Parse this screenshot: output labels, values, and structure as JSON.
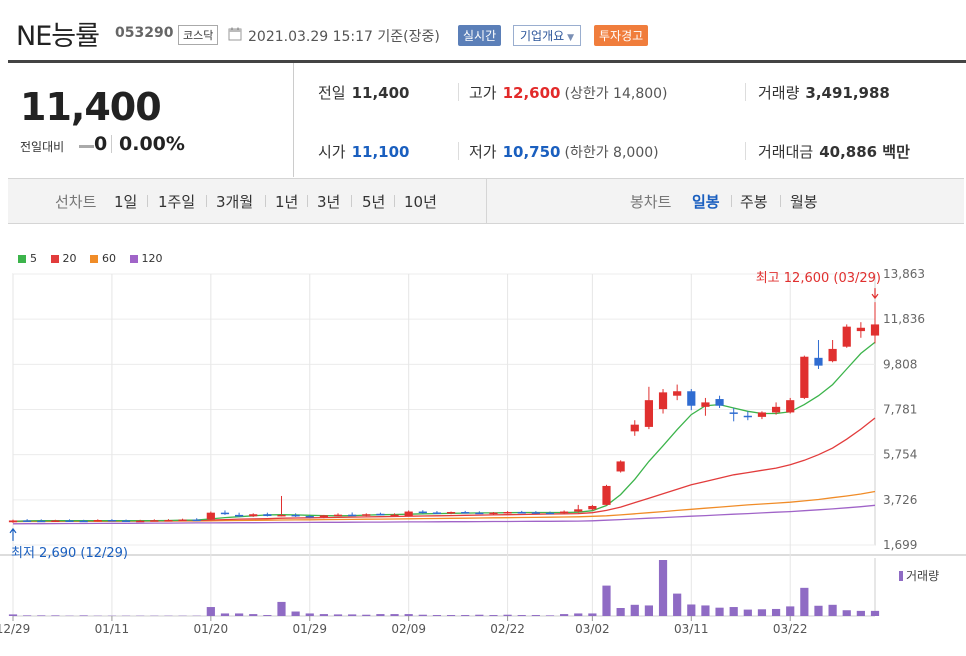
{
  "header": {
    "name": "NE능률",
    "code": "053290",
    "market": "코스닥",
    "datetime": "2021.03.29 15:17  기준(장중)",
    "btn_live": "실시간",
    "btn_info": "기업개요",
    "btn_warn": "투자경고"
  },
  "price": {
    "current": "11,400",
    "change_label": "전일대비",
    "change_value": "0",
    "change_rate": "0.00%"
  },
  "quote": {
    "prev_label": "전일",
    "prev": "11,400",
    "high_label": "고가",
    "high": "12,600",
    "upper_limit": "(상한가 14,800)",
    "volume_label": "거래량",
    "volume": "3,491,988",
    "open_label": "시가",
    "open": "11,100",
    "low_label": "저가",
    "low": "10,750",
    "lower_limit": "(하한가 8,000)",
    "amount_label": "거래대금",
    "amount": "40,886 백만"
  },
  "tabs": {
    "line_title": "선차트",
    "line": [
      "1일",
      "1주일",
      "3개월",
      "1년",
      "3년",
      "5년",
      "10년"
    ],
    "candle_title": "봉차트",
    "candle": [
      "일봉",
      "주봉",
      "월봉"
    ],
    "candle_active": 0
  },
  "chart_data": {
    "type": "candlestick",
    "legend": [
      {
        "name": "5",
        "color": "#3cb44b"
      },
      {
        "name": "20",
        "color": "#e23c3c"
      },
      {
        "name": "60",
        "color": "#f08c28"
      },
      {
        "name": "120",
        "color": "#a064c8"
      }
    ],
    "yticks": [
      "13,863",
      "11,836",
      "9,808",
      "7,781",
      "5,754",
      "3,726",
      "1,699"
    ],
    "ylim": [
      1699,
      13863
    ],
    "xticks": [
      "12/29",
      "01/11",
      "01/20",
      "01/29",
      "02/09",
      "02/22",
      "03/02",
      "03/11",
      "03/22"
    ],
    "xtick_index": [
      0,
      7,
      14,
      21,
      28,
      35,
      41,
      48,
      55
    ],
    "max_label": "최고 12,600 (03/29)",
    "min_label": "최저 2,690 (12/29)",
    "volume_label": "거래량",
    "ohlc": [
      [
        2720,
        2840,
        2690,
        2800
      ],
      [
        2800,
        2860,
        2760,
        2790
      ],
      [
        2790,
        2850,
        2750,
        2780
      ],
      [
        2780,
        2830,
        2740,
        2800
      ],
      [
        2800,
        2850,
        2760,
        2790
      ],
      [
        2790,
        2830,
        2750,
        2770
      ],
      [
        2770,
        2850,
        2750,
        2820
      ],
      [
        2820,
        2860,
        2780,
        2800
      ],
      [
        2800,
        2840,
        2760,
        2780
      ],
      [
        2780,
        2830,
        2750,
        2790
      ],
      [
        2790,
        2850,
        2760,
        2810
      ],
      [
        2810,
        2860,
        2780,
        2820
      ],
      [
        2820,
        2880,
        2790,
        2840
      ],
      [
        2840,
        2900,
        2800,
        2830
      ],
      [
        2850,
        3200,
        2820,
        3150
      ],
      [
        3150,
        3250,
        3050,
        3100
      ],
      [
        3050,
        3150,
        2950,
        2980
      ],
      [
        2990,
        3120,
        2960,
        3080
      ],
      [
        3080,
        3150,
        2980,
        3000
      ],
      [
        3000,
        3900,
        2980,
        3050
      ],
      [
        3050,
        3120,
        2960,
        3020
      ],
      [
        3000,
        3050,
        2920,
        2950
      ],
      [
        2950,
        3050,
        2900,
        3030
      ],
      [
        3030,
        3120,
        2990,
        3060
      ],
      [
        3060,
        3160,
        3000,
        3050
      ],
      [
        3050,
        3120,
        2990,
        3080
      ],
      [
        3100,
        3150,
        3030,
        3040
      ],
      [
        3040,
        3120,
        3000,
        3060
      ],
      [
        3000,
        3250,
        2980,
        3200
      ],
      [
        3200,
        3260,
        3100,
        3150
      ],
      [
        3160,
        3220,
        3100,
        3130
      ],
      [
        3130,
        3200,
        3080,
        3180
      ],
      [
        3180,
        3230,
        3120,
        3150
      ],
      [
        3150,
        3210,
        3090,
        3120
      ],
      [
        3120,
        3180,
        3060,
        3150
      ],
      [
        3150,
        3220,
        3100,
        3180
      ],
      [
        3180,
        3230,
        3120,
        3170
      ],
      [
        3170,
        3220,
        3100,
        3150
      ],
      [
        3150,
        3200,
        3080,
        3120
      ],
      [
        3150,
        3250,
        3100,
        3200
      ],
      [
        3200,
        3500,
        3150,
        3300
      ],
      [
        3300,
        3500,
        3250,
        3450
      ],
      [
        3500,
        4400,
        3480,
        4350
      ],
      [
        5000,
        5500,
        4950,
        5450
      ],
      [
        6800,
        7300,
        6600,
        7100
      ],
      [
        7000,
        8800,
        6900,
        8200
      ],
      [
        7800,
        8700,
        7600,
        8550
      ],
      [
        8400,
        8900,
        8200,
        8600
      ],
      [
        8600,
        8700,
        7750,
        7950
      ],
      [
        7900,
        8300,
        7500,
        8100
      ],
      [
        8250,
        8400,
        7850,
        7950
      ],
      [
        7650,
        7850,
        7250,
        7600
      ],
      [
        7500,
        7700,
        7300,
        7450
      ],
      [
        7450,
        7700,
        7350,
        7650
      ],
      [
        7650,
        8100,
        7550,
        7900
      ],
      [
        7650,
        8300,
        7600,
        8200
      ],
      [
        8300,
        10200,
        8250,
        10150
      ],
      [
        10100,
        10900,
        9600,
        9750
      ],
      [
        9950,
        10900,
        9900,
        10500
      ],
      [
        10600,
        11600,
        10550,
        11500
      ],
      [
        11300,
        11700,
        11000,
        11450
      ],
      [
        11100,
        12600,
        10750,
        11600
      ]
    ],
    "ma5": [
      2760,
      2780,
      2790,
      2790,
      2790,
      2790,
      2790,
      2790,
      2790,
      2790,
      2790,
      2800,
      2810,
      2820,
      2870,
      2930,
      2970,
      3010,
      3050,
      3060,
      3050,
      3030,
      3020,
      3010,
      3020,
      3040,
      3060,
      3070,
      3080,
      3100,
      3110,
      3120,
      3130,
      3140,
      3140,
      3150,
      3160,
      3160,
      3160,
      3160,
      3170,
      3240,
      3470,
      3960,
      4650,
      5450,
      6150,
      6880,
      7550,
      7950,
      8000,
      7850,
      7700,
      7600,
      7600,
      7680,
      8000,
      8400,
      8900,
      9600,
      10300,
      10800
    ],
    "ma20": [
      2770,
      2775,
      2780,
      2780,
      2785,
      2785,
      2785,
      2785,
      2790,
      2790,
      2790,
      2795,
      2800,
      2800,
      2820,
      2840,
      2860,
      2870,
      2880,
      2900,
      2910,
      2920,
      2930,
      2940,
      2950,
      2960,
      2970,
      2980,
      2990,
      3000,
      3010,
      3020,
      3030,
      3040,
      3050,
      3060,
      3070,
      3080,
      3090,
      3100,
      3110,
      3150,
      3250,
      3400,
      3600,
      3800,
      4000,
      4200,
      4400,
      4550,
      4700,
      4850,
      4950,
      5050,
      5150,
      5300,
      5500,
      5750,
      6050,
      6450,
      6900,
      7400
    ],
    "ma60": [
      2750,
      2752,
      2754,
      2756,
      2758,
      2760,
      2762,
      2764,
      2766,
      2768,
      2770,
      2772,
      2775,
      2778,
      2785,
      2792,
      2800,
      2806,
      2812,
      2820,
      2826,
      2832,
      2838,
      2844,
      2850,
      2856,
      2862,
      2868,
      2875,
      2882,
      2890,
      2897,
      2904,
      2911,
      2918,
      2925,
      2932,
      2940,
      2948,
      2956,
      2965,
      2985,
      3010,
      3050,
      3100,
      3150,
      3200,
      3250,
      3300,
      3350,
      3400,
      3450,
      3500,
      3540,
      3580,
      3620,
      3680,
      3740,
      3820,
      3900,
      3990,
      4100
    ],
    "ma120": [
      2650,
      2653,
      2656,
      2659,
      2662,
      2665,
      2668,
      2671,
      2674,
      2677,
      2680,
      2683,
      2686,
      2689,
      2692,
      2695,
      2698,
      2701,
      2704,
      2707,
      2710,
      2713,
      2716,
      2719,
      2722,
      2725,
      2728,
      2731,
      2734,
      2737,
      2740,
      2743,
      2746,
      2749,
      2752,
      2755,
      2758,
      2761,
      2764,
      2767,
      2770,
      2785,
      2810,
      2840,
      2870,
      2900,
      2930,
      2960,
      2990,
      3020,
      3050,
      3080,
      3110,
      3140,
      3170,
      3200,
      3240,
      3280,
      3320,
      3370,
      3420,
      3480
    ],
    "volume": [
      5,
      2,
      2,
      2,
      1,
      2,
      1,
      1,
      1,
      1,
      1,
      1,
      1,
      1,
      28,
      8,
      8,
      6,
      3,
      44,
      14,
      8,
      6,
      5,
      5,
      4,
      6,
      6,
      6,
      4,
      3,
      3,
      3,
      4,
      3,
      4,
      3,
      3,
      2,
      6,
      8,
      8,
      95,
      25,
      35,
      33,
      175,
      70,
      36,
      33,
      26,
      28,
      20,
      21,
      22,
      30,
      88,
      32,
      35,
      18,
      16,
      16
    ]
  }
}
